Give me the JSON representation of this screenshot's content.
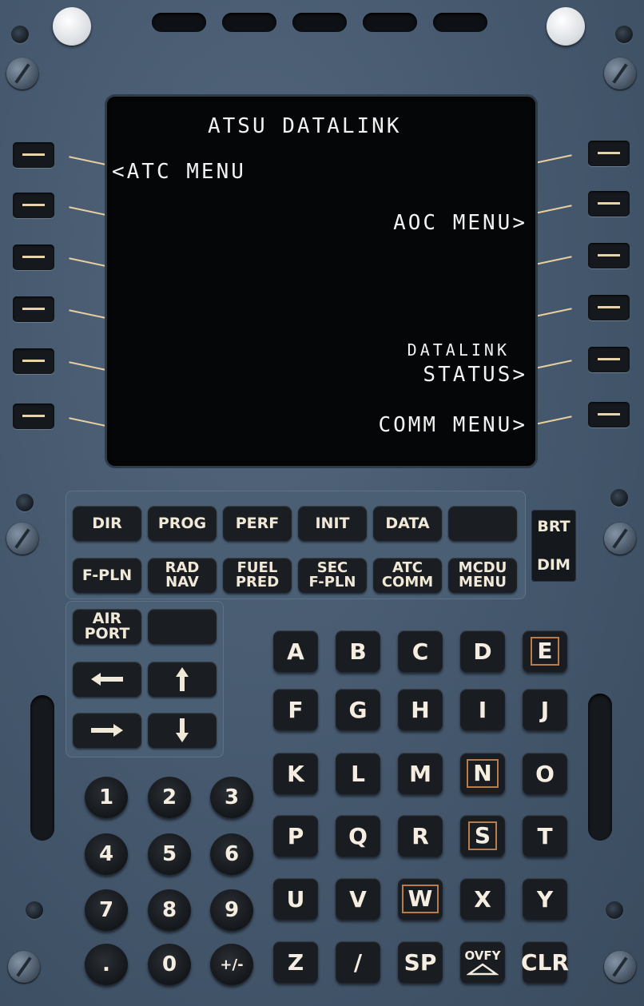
{
  "screen": {
    "title": "ATSU DATALINK",
    "left": [
      "<ATC MENU"
    ],
    "right": [
      "AOC MENU>",
      "DATALINK",
      "STATUS>",
      "COMM MENU>"
    ]
  },
  "function_keys": {
    "row1": [
      "DIR",
      "PROG",
      "PERF",
      "INIT",
      "DATA",
      ""
    ],
    "row2": [
      [
        "F-PLN",
        ""
      ],
      [
        "RAD",
        "NAV"
      ],
      [
        "FUEL",
        "PRED"
      ],
      [
        "SEC",
        "F-PLN"
      ],
      [
        "ATC",
        "COMM"
      ],
      [
        "MCDU",
        "MENU"
      ]
    ],
    "brt": "BRT",
    "dim": "DIM"
  },
  "nav_keys": {
    "airport": [
      "AIR",
      "PORT"
    ],
    "blank": "",
    "left_icon": "arrow-left-icon",
    "up_icon": "arrow-up-icon",
    "right_icon": "arrow-right-icon",
    "down_icon": "arrow-down-icon"
  },
  "alpha_keys": [
    [
      "A",
      "B",
      "C",
      "D",
      "E"
    ],
    [
      "F",
      "G",
      "H",
      "I",
      "J"
    ],
    [
      "K",
      "L",
      "M",
      "N",
      "O"
    ],
    [
      "P",
      "Q",
      "R",
      "S",
      "T"
    ],
    [
      "U",
      "V",
      "W",
      "X",
      "Y"
    ],
    [
      "Z",
      "/",
      "SP",
      "OVFY",
      "CLR"
    ]
  ],
  "numeric_keys": [
    [
      "1",
      "2",
      "3"
    ],
    [
      "4",
      "5",
      "6"
    ],
    [
      "7",
      "8",
      "9"
    ],
    [
      ".",
      "0",
      "+/-"
    ]
  ],
  "colors": {
    "panel": "#44576c",
    "key": "#1a1e22",
    "key_text": "#f1e9d8",
    "screen_text": "#f2f2f2",
    "lsk_indicator": "#e8cfa0",
    "boxed_key_outline": "#b87b4a"
  }
}
